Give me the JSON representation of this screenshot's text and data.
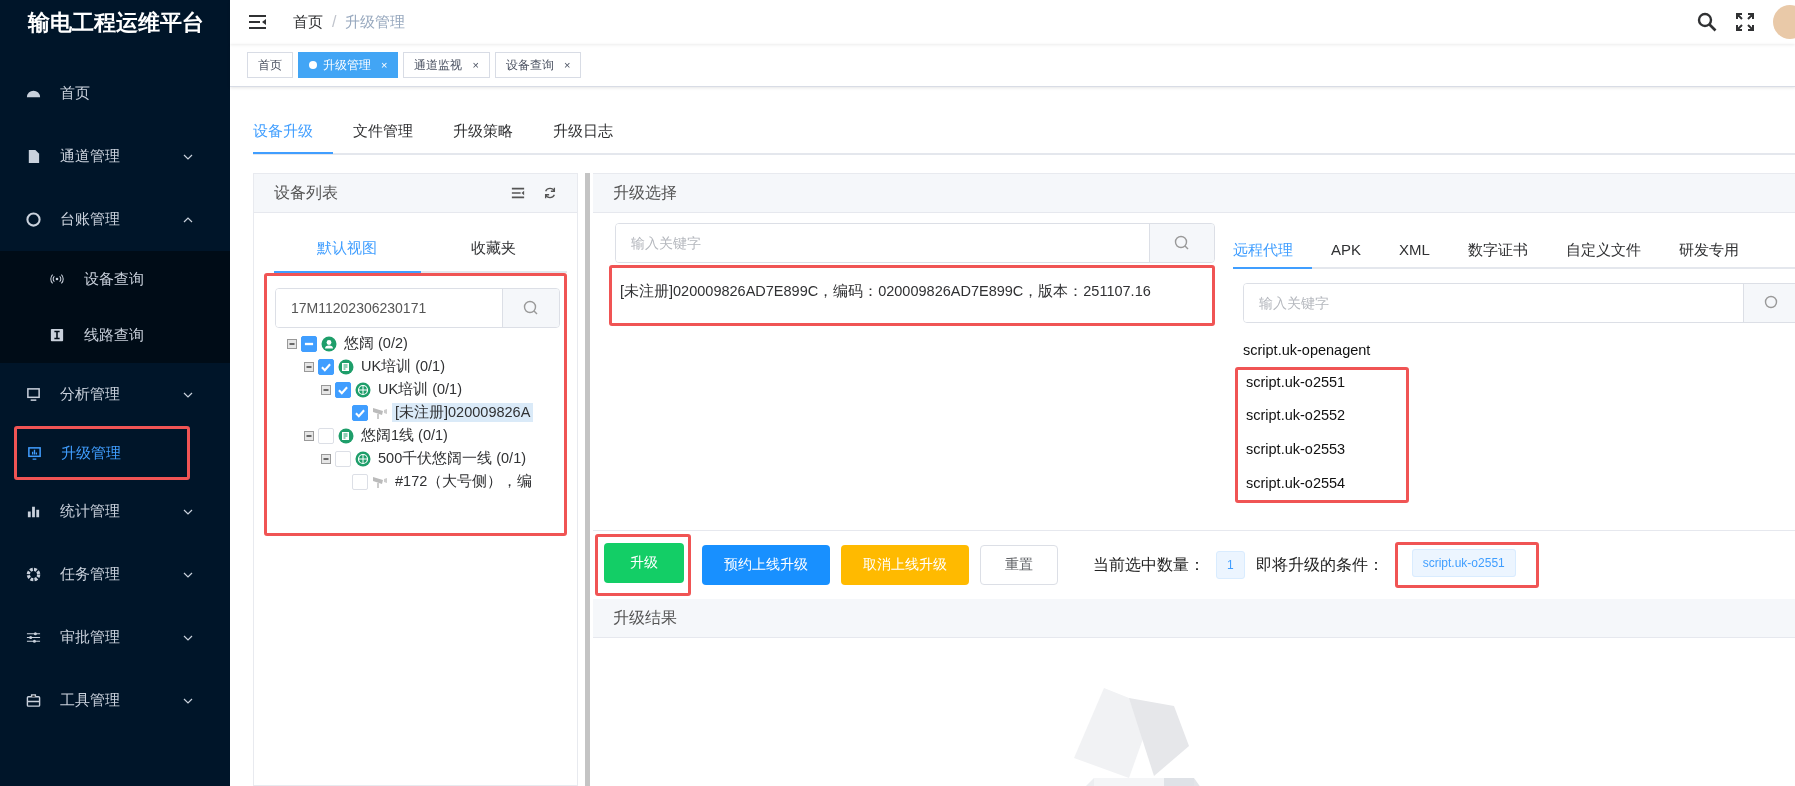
{
  "sidebar": {
    "title": "输电工程运维平台",
    "items": [
      {
        "label": "首页",
        "kind": "link",
        "selected": false,
        "marked": false
      },
      {
        "label": "通道管理",
        "kind": "group",
        "expanded": false,
        "selected": false,
        "marked": false
      },
      {
        "label": "台账管理",
        "kind": "group",
        "expanded": true,
        "selected": false,
        "marked": false,
        "children": [
          {
            "label": "设备查询",
            "selected": false
          },
          {
            "label": "线路查询",
            "selected": false
          }
        ]
      },
      {
        "label": "分析管理",
        "kind": "group",
        "expanded": false,
        "selected": false,
        "marked": false
      },
      {
        "label": "升级管理",
        "kind": "link",
        "selected": true,
        "marked": true
      },
      {
        "label": "统计管理",
        "kind": "group",
        "expanded": false,
        "selected": false,
        "marked": false
      },
      {
        "label": "任务管理",
        "kind": "group",
        "expanded": false,
        "selected": false,
        "marked": false
      },
      {
        "label": "审批管理",
        "kind": "group",
        "expanded": false,
        "selected": false,
        "marked": false
      },
      {
        "label": "工具管理",
        "kind": "group",
        "expanded": false,
        "selected": false,
        "marked": false
      }
    ]
  },
  "breadcrumb": [
    "首页",
    "升级管理"
  ],
  "breadcrumb_separator": "/",
  "tags": [
    {
      "label": "首页",
      "selected": false
    },
    {
      "label": "升级管理",
      "selected": true,
      "close": "×"
    },
    {
      "label": "通道监视",
      "selected": false,
      "close": "×"
    },
    {
      "label": "设备查询",
      "selected": false,
      "close": "×"
    }
  ],
  "page_tabs": [
    {
      "label": "设备升级",
      "selected": true
    },
    {
      "label": "文件管理",
      "selected": false
    },
    {
      "label": "升级策略",
      "selected": false
    },
    {
      "label": "升级日志",
      "selected": false
    }
  ],
  "device_list": {
    "title": "设备列表",
    "view_tabs": [
      {
        "label": "默认视图",
        "selected": true
      },
      {
        "label": "收藏夹",
        "selected": false
      }
    ],
    "marked": true,
    "search": {
      "value": "17M11202306230171"
    },
    "tree": [
      {
        "label": "悠阔 (0/2)",
        "kind": "area",
        "indeterminate": true,
        "children": [
          {
            "label": "UK培训 (0/1)",
            "kind": "line",
            "checked": true,
            "children": [
              {
                "label": "UK培训 (0/1)",
                "kind": "station",
                "checked": true,
                "children": [
                  {
                    "label": "[未注册]020009826A",
                    "kind": "device",
                    "checked": true,
                    "selected": true
                  }
                ]
              }
            ]
          },
          {
            "label": "悠阔1线 (0/1)",
            "kind": "line",
            "checked": false,
            "children": [
              {
                "label": "500千伏悠阔一线 (0/1)",
                "kind": "station",
                "checked": false,
                "children": [
                  {
                    "label": "#172（大号侧），编",
                    "kind": "device",
                    "checked": false,
                    "selected": false
                  }
                ]
              }
            ]
          }
        ]
      }
    ]
  },
  "upgrade_select": {
    "title": "升级选择",
    "search": {
      "placeholder": "输入关键字"
    },
    "selected_devices": [
      "[未注册]020009826AD7E899C，编码：020009826AD7E899C，版本：251107.16"
    ],
    "selected_marked": true,
    "file_tabs": [
      {
        "label": "远程代理",
        "selected": true
      },
      {
        "label": "APK",
        "selected": false
      },
      {
        "label": "XML",
        "selected": false
      },
      {
        "label": "数字证书",
        "selected": false
      },
      {
        "label": "自定义文件",
        "selected": false
      },
      {
        "label": "研发专用",
        "selected": false
      }
    ],
    "file_search": {
      "placeholder": "输入关键字"
    },
    "files": [
      {
        "label": "script.uk-openagent",
        "marked": false
      },
      {
        "label": "script.uk-o2551",
        "marked": true
      },
      {
        "label": "script.uk-o2552",
        "marked": true
      },
      {
        "label": "script.uk-o2553",
        "marked": true
      },
      {
        "label": "script.uk-o2554",
        "marked": true
      }
    ]
  },
  "actions": {
    "buttons": [
      {
        "label": "升级",
        "kind": "success",
        "marked": true
      },
      {
        "label": "预约上线升级",
        "kind": "primary",
        "marked": false
      },
      {
        "label": "取消上线升级",
        "kind": "warning",
        "marked": false
      },
      {
        "label": "重置",
        "kind": "default",
        "marked": false
      }
    ],
    "count_label": "当前选中数量：",
    "count": "1",
    "condition_label": "即将升级的条件：",
    "conditions": [
      "script.uk-o2551"
    ],
    "conditions_marked": true
  },
  "result": {
    "title": "升级结果"
  }
}
